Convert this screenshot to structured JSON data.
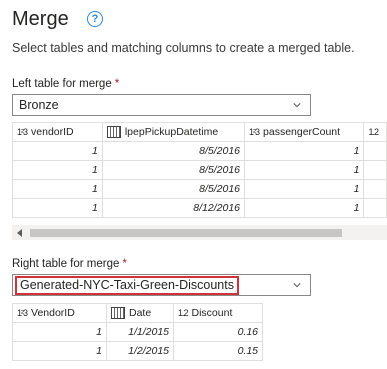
{
  "header": {
    "title": "Merge",
    "help_icon": "question-circle-icon",
    "description": "Select tables and matching columns to create a merged table."
  },
  "left_table": {
    "label": "Left table for merge",
    "required_mark": "*",
    "selected": "Bronze",
    "columns": [
      {
        "type_icon": "1²3",
        "name": "vendorID"
      },
      {
        "type_icon": "calendar",
        "name": "lpepPickupDatetime"
      },
      {
        "type_icon": "1²3",
        "name": "passengerCount"
      },
      {
        "type_icon": "1.2",
        "name": ""
      }
    ],
    "rows": [
      [
        "1",
        "8/5/2016",
        "1"
      ],
      [
        "1",
        "8/5/2016",
        "1"
      ],
      [
        "1",
        "8/5/2016",
        "1"
      ],
      [
        "1",
        "8/12/2016",
        "1"
      ]
    ]
  },
  "right_table": {
    "label": "Right table for merge",
    "required_mark": "*",
    "selected": "Generated-NYC-Taxi-Green-Discounts",
    "columns": [
      {
        "type_icon": "1²3",
        "name": "VendorID"
      },
      {
        "type_icon": "calendar",
        "name": "Date"
      },
      {
        "type_icon": "1.2",
        "name": "Discount"
      }
    ],
    "rows": [
      [
        "1",
        "1/1/2015",
        "0.16"
      ],
      [
        "1",
        "1/2/2015",
        "0.15"
      ]
    ]
  },
  "colors": {
    "accent": "#2b88d8",
    "highlight_border": "#d13438",
    "required": "#a4262c"
  }
}
